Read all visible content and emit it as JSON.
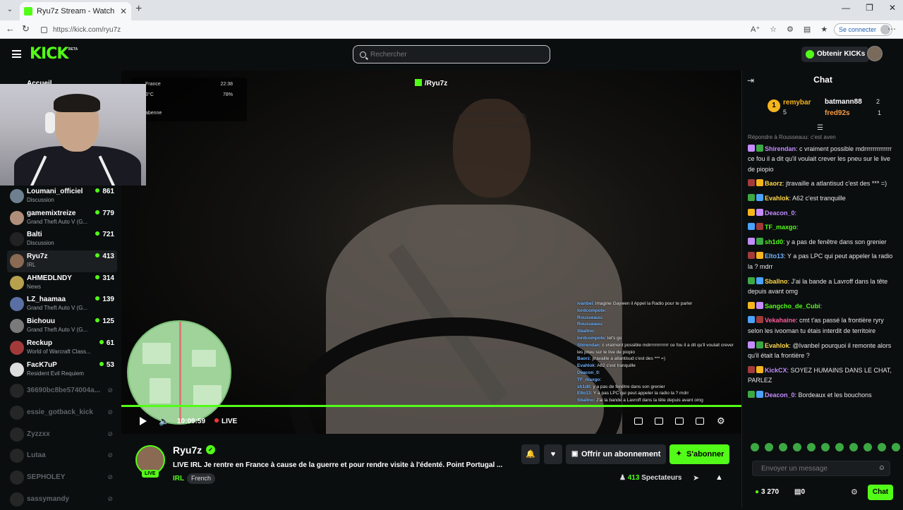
{
  "browser": {
    "tab_title": "Ryu7z Stream - Watch Live on Kick",
    "url": "https://kick.com/ryu7z",
    "signin_label": "Se connecter"
  },
  "header": {
    "logo": "KICK",
    "beta": "BETA",
    "search_placeholder": "Rechercher",
    "kicks_label": "Obtenir KICKs"
  },
  "sidebar": {
    "home_label": "Accueil",
    "channels": [
      {
        "name": "Loumani_officiel",
        "category": "Discussion",
        "viewers": "861",
        "color": "#6e7f8f"
      },
      {
        "name": "gamemixtreize",
        "category": "Grand Theft Auto V (G...",
        "viewers": "779",
        "color": "#b08f7a"
      },
      {
        "name": "Balti",
        "category": "Discussion",
        "viewers": "721",
        "color": "#222"
      },
      {
        "name": "Ryu7z",
        "category": "IRL",
        "viewers": "413",
        "color": "#8a6a52"
      },
      {
        "name": "AHMEDLNDY",
        "category": "News",
        "viewers": "314",
        "color": "#b8a14e"
      },
      {
        "name": "LZ_haamaa",
        "category": "Grand Theft Auto V (G...",
        "viewers": "139",
        "color": "#5a6fa3"
      },
      {
        "name": "Bichouu",
        "category": "Grand Theft Auto V (G...",
        "viewers": "125",
        "color": "#7a7a7a"
      },
      {
        "name": "Reckup",
        "category": "World of Warcraft Class...",
        "viewers": "61",
        "color": "#a33a3a"
      },
      {
        "name": "FacK7uP",
        "category": "Resident Evil Requiem",
        "viewers": "53",
        "color": "#ddd"
      }
    ],
    "offline": [
      {
        "name": "36690bc8be574004a...",
        "icon": "offline-icon"
      },
      {
        "name": "essie_gotback_kick",
        "icon": "offline-icon"
      },
      {
        "name": "Zyzzxx",
        "icon": "offline-icon"
      },
      {
        "name": "Lutaa",
        "icon": "offline-icon"
      },
      {
        "name": "SEPHOLEY",
        "icon": "offline-icon"
      },
      {
        "name": "sassymandy",
        "icon": "offline-icon"
      }
    ]
  },
  "video": {
    "overlay_channel": "/Ryu7z",
    "weather": {
      "location": "France",
      "time": "22:38",
      "temp": "3°C",
      "humidity": "78%",
      "place": "abenne"
    },
    "overlay_chat": [
      {
        "user": "ivanbel",
        "text": "imagine Gaywen il Appel la Radio pour te parler"
      },
      {
        "user": "lordcompote",
        "text": ""
      },
      {
        "user": "Rousseauu",
        "text": ""
      },
      {
        "user": "Rousseauu",
        "text": ""
      },
      {
        "user": "Sballno",
        "text": ""
      },
      {
        "user": "lordcompote",
        "text": "let's go"
      },
      {
        "user": "Shirendan",
        "text": "c vraiment possible mdrrrrrrrrrrrrr ce fou il a dit qu'il voulait crever les pneu sur le live de piopio"
      },
      {
        "user": "Baorz",
        "text": "jtravaille a atlantisud c'est des *** =)"
      },
      {
        "user": "Evahlok",
        "text": "A62 c'est tranquille"
      },
      {
        "user": "Deacon_0",
        "text": ""
      },
      {
        "user": "TF_maxgo",
        "text": ""
      },
      {
        "user": "sh1d0",
        "text": "y a pas de fenêtre dans son grenier"
      },
      {
        "user": "Elto13",
        "text": "Y a pas LPC qui peut appeler la radio la ? mdrr"
      },
      {
        "user": "Sballno",
        "text": "J'ai la bande a Lavroff dans la tête depuis avant omg"
      }
    ],
    "time": "10:09:59",
    "live_label": "LIVE"
  },
  "stream": {
    "streamer": "Ryu7z",
    "live_badge": "LIVE",
    "title": "LIVE IRL Je rentre en France à cause de la guerre et pour rendre visite à l'édenté. Point Portugal ...",
    "category": "IRL",
    "tag": "French",
    "gift_label": "Offrir un abonnement",
    "subscribe_label": "S'abonner",
    "viewers": "413",
    "viewers_label": "Spectateurs"
  },
  "chat": {
    "title": "Chat",
    "gifters": {
      "rank": "1",
      "top": {
        "name": "remybar",
        "count": "5"
      },
      "second": {
        "name": "batmann88",
        "count": "2"
      },
      "third": {
        "name": "fred92s",
        "count": "1"
      }
    },
    "reply_text": "Répondre à Rousseauu: c'est aven",
    "messages": [
      {
        "user": "Shirendan",
        "color": "#c58cff",
        "text": "c vraiment possible mdrrrrrrrrrrrrr ce fou il a dit qu'il voulait crever les pneu sur le live de piopio"
      },
      {
        "user": "Baorz",
        "color": "#ffd84a",
        "text": "jtravaille a atlantisud c'est des *** =)"
      },
      {
        "user": "Evahlok",
        "color": "#ffd84a",
        "text": "A62 c'est tranquille"
      },
      {
        "user": "Deacon_0",
        "color": "#c58cff",
        "text": ""
      },
      {
        "user": "TF_maxgo",
        "color": "#53fc18",
        "text": ""
      },
      {
        "user": "sh1d0",
        "color": "#53fc18",
        "text": "y a pas de fenêtre dans son grenier"
      },
      {
        "user": "Elto13",
        "color": "#6fb4ff",
        "text": "Y a pas LPC qui peut appeler la radio la ? mdrr"
      },
      {
        "user": "Sballno",
        "color": "#ffd84a",
        "text": "J'ai la bande a Lavroff dans la tête depuis avant omg"
      },
      {
        "user": "Sangcho_de_Cubi",
        "color": "#53fc18",
        "text": ""
      },
      {
        "user": "Vekahaine",
        "color": "#ff5a9a",
        "text": "cmt t'as passé la frontière ryry selon les ivooman tu étais interdit de territoire"
      },
      {
        "user": "Evahlok",
        "color": "#ffd84a",
        "text": "@Ivanbel pourquoi il remonte alors qu'il était la frontière ?"
      },
      {
        "user": "KickCX",
        "color": "#c58cff",
        "text": "SOYEZ HUMAINS DANS LE CHAT, PARLEZ"
      },
      {
        "user": "Deacon_0",
        "color": "#c58cff",
        "text": "Bordeaux et les bouchons"
      }
    ],
    "input_placeholder": "Envoyer un message",
    "points": "3 270",
    "kicks": "0",
    "send_label": "Chat"
  }
}
